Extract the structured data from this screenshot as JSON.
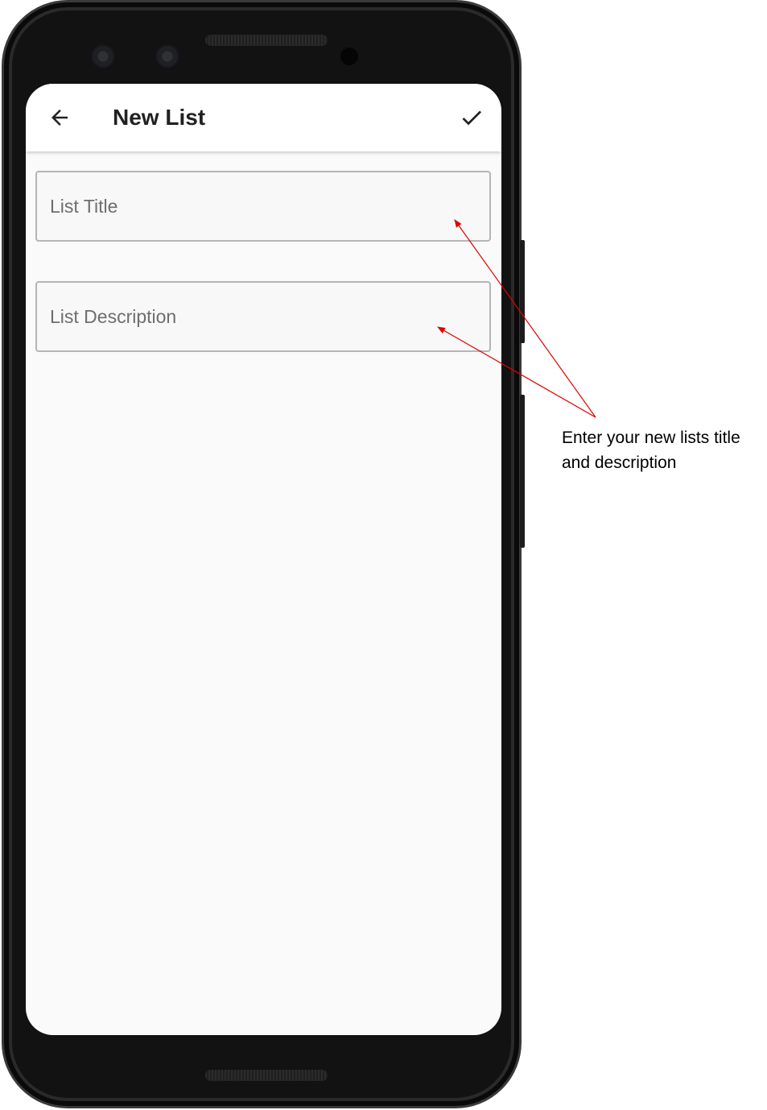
{
  "app_bar": {
    "title": "New List",
    "back_icon": "arrow-left-icon",
    "confirm_icon": "check-icon"
  },
  "form": {
    "title_field": {
      "placeholder": "List Title",
      "value": ""
    },
    "description_field": {
      "placeholder": "List Description",
      "value": ""
    }
  },
  "annotation": {
    "text": "Enter your new lists title and description",
    "color": "#e00000"
  },
  "colors": {
    "screen_background": "#fafafa",
    "app_bar_background": "#ffffff",
    "field_border": "#b5b5b5",
    "frame": "#121212"
  }
}
